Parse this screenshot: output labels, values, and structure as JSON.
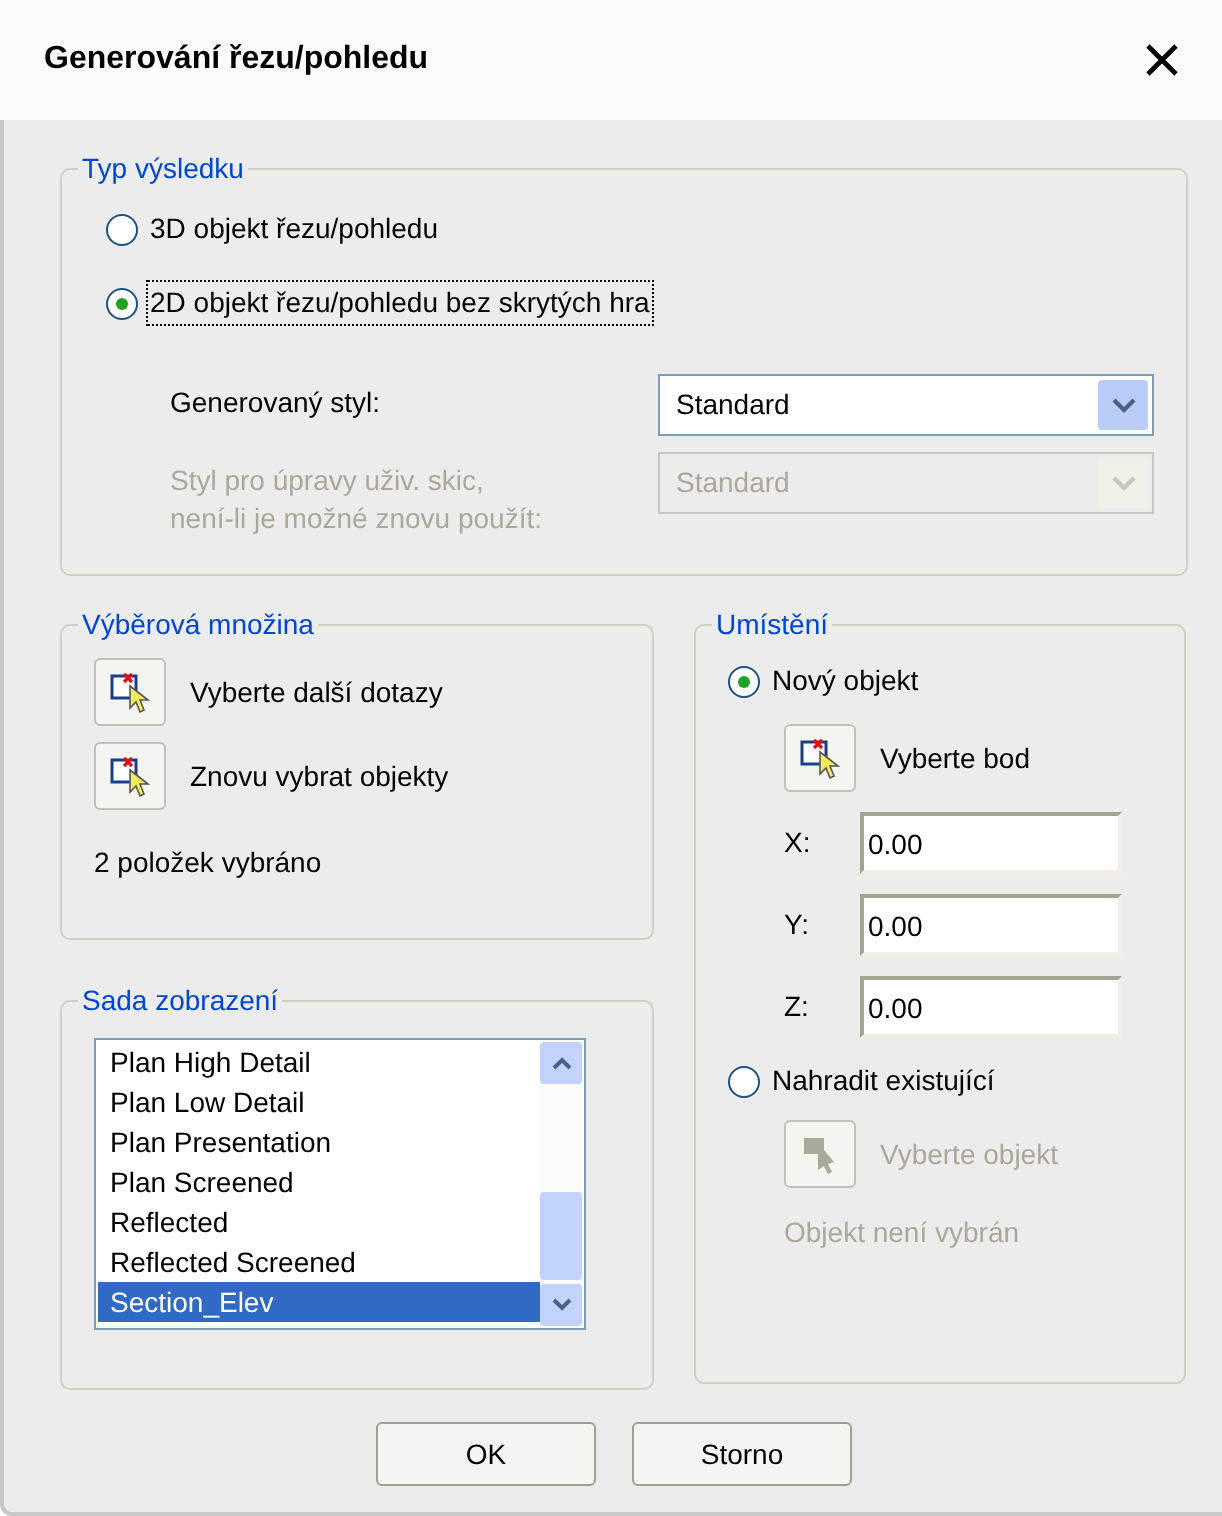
{
  "window": {
    "title": "Generování řezu/pohledu"
  },
  "result_type": {
    "title": "Typ výsledku",
    "options": [
      {
        "label": "3D objekt řezu/pohledu",
        "selected": false,
        "focused": false
      },
      {
        "label": "2D objekt řezu/pohledu bez skrytých hra",
        "selected": true,
        "focused": true
      }
    ],
    "fields": [
      {
        "label": "Generovaný styl:",
        "value": "Standard",
        "disabled": false
      },
      {
        "label": "Styl pro úpravy uživ. skic, není-li je možné znovu použít:",
        "value": "Standard",
        "disabled": true
      }
    ]
  },
  "selection_set": {
    "title": "Výběrová množina",
    "actions": [
      {
        "label": "Vyberte další dotazy"
      },
      {
        "label": "Znovu vybrat objekty"
      }
    ],
    "status": "2 položek vybráno"
  },
  "display_set": {
    "title": "Sada zobrazení",
    "items": [
      {
        "label": "Plan High Detail",
        "selected": false
      },
      {
        "label": "Plan Low Detail",
        "selected": false
      },
      {
        "label": "Plan Presentation",
        "selected": false
      },
      {
        "label": "Plan Screened",
        "selected": false
      },
      {
        "label": "Reflected",
        "selected": false
      },
      {
        "label": "Reflected Screened",
        "selected": false
      },
      {
        "label": "Section_Elev",
        "selected": true
      }
    ]
  },
  "placement": {
    "title": "Umístění",
    "new_object": {
      "label": "Nový objekt",
      "selected": true,
      "pick": {
        "label": "Vyberte bod",
        "disabled": false
      },
      "coords": [
        {
          "label": "X:",
          "value": "0.00"
        },
        {
          "label": "Y:",
          "value": "0.00"
        },
        {
          "label": "Z:",
          "value": "0.00"
        }
      ]
    },
    "replace": {
      "label": "Nahradit existující",
      "selected": false,
      "pick": {
        "label": "Vyberte objekt",
        "disabled": true
      },
      "status": {
        "text": "Objekt není vybrán",
        "disabled": true
      }
    }
  },
  "buttons": [
    {
      "label": "OK"
    },
    {
      "label": "Storno"
    }
  ]
}
